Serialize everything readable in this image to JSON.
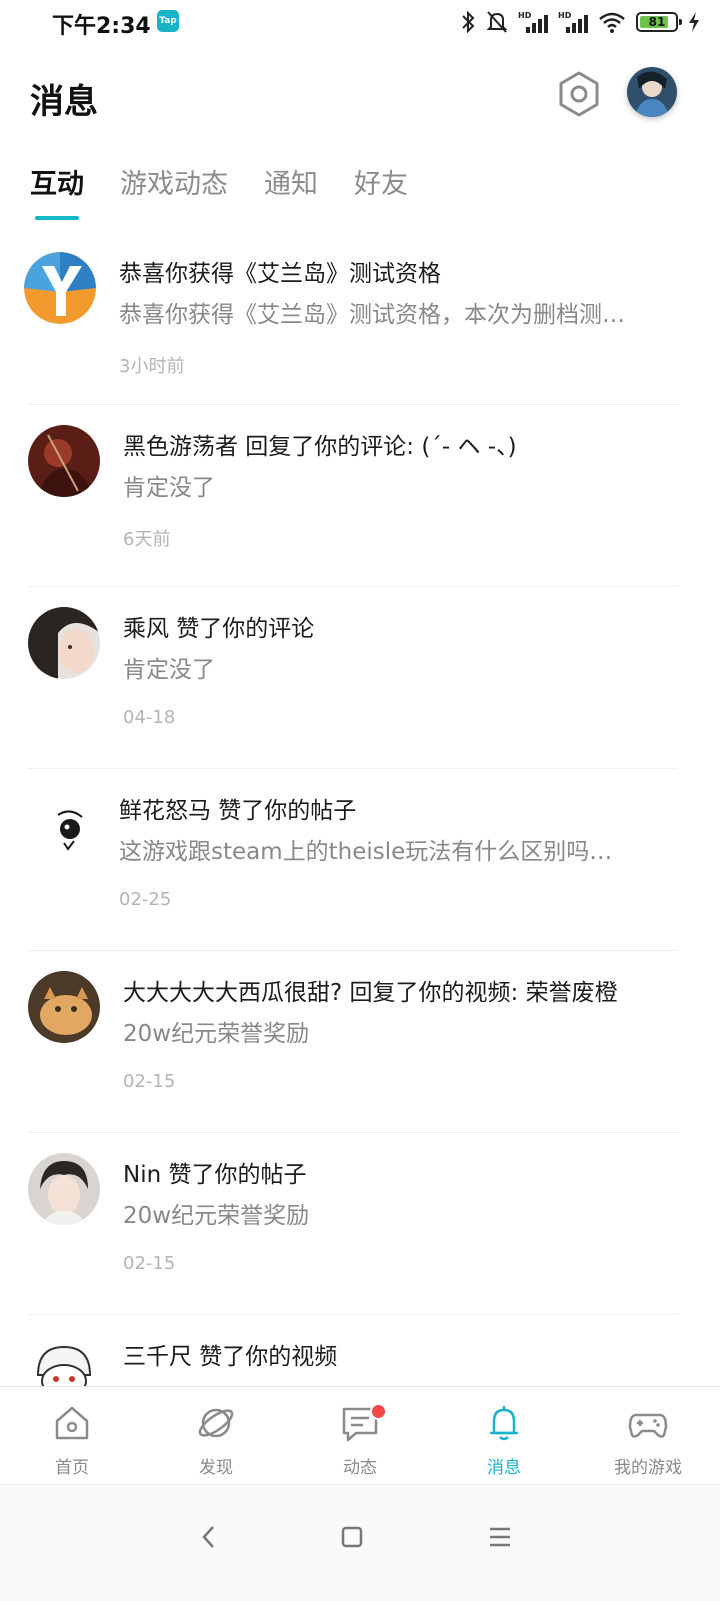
{
  "status_bar": {
    "time": "下午2:34",
    "app_badge": "Tap",
    "battery_level": "81",
    "battery_fraction": 0.81
  },
  "header": {
    "title": "消息",
    "settings_icon": "settings-hexagon-icon",
    "avatar_icon": "user-avatar"
  },
  "tabs": [
    {
      "label": "互动",
      "active": true
    },
    {
      "label": "游戏动态",
      "active": false
    },
    {
      "label": "通知",
      "active": false
    },
    {
      "label": "好友",
      "active": false
    }
  ],
  "messages": [
    {
      "title": "恭喜你获得《艾兰岛》测试资格",
      "body": "恭喜你获得《艾兰岛》测试资格，本次为删档测…",
      "time": "3小时前",
      "avatar": "game-logo-y"
    },
    {
      "title": "黑色游荡者 回复了你的评论: (´- ヘ -、)",
      "body": "肯定没了",
      "time": "6天前",
      "avatar": "user-avatar"
    },
    {
      "title": "乘风 赞了你的评论",
      "body": "肯定没了",
      "time": "04-18",
      "avatar": "user-avatar"
    },
    {
      "title": "鲜花怒马 赞了你的帖子",
      "body": "这游戏跟steam上的theisle玩法有什么区别吗…",
      "time": "02-25",
      "avatar": "user-avatar"
    },
    {
      "title": "大大大大大西瓜很甜? 回复了你的视频: 荣誉废橙",
      "body": "20w纪元荣誉奖励",
      "time": "02-15",
      "avatar": "user-avatar"
    },
    {
      "title": "Nin 赞了你的帖子",
      "body": "20w纪元荣誉奖励",
      "time": "02-15",
      "avatar": "user-avatar"
    },
    {
      "title": "三千尺 赞了你的视频",
      "body": "",
      "time": "",
      "avatar": "user-avatar"
    }
  ],
  "bottom_nav": [
    {
      "label": "首页",
      "icon": "home-icon",
      "active": false
    },
    {
      "label": "发现",
      "icon": "discover-planet-icon",
      "active": false
    },
    {
      "label": "动态",
      "icon": "feed-chat-icon",
      "active": false,
      "badge": true
    },
    {
      "label": "消息",
      "icon": "bell-icon",
      "active": true
    },
    {
      "label": "我的游戏",
      "icon": "gamepad-icon",
      "active": false
    }
  ],
  "colors": {
    "accent": "#16b4c6",
    "badge": "#ef4a4a",
    "battery_fill": "#6cc24a"
  }
}
